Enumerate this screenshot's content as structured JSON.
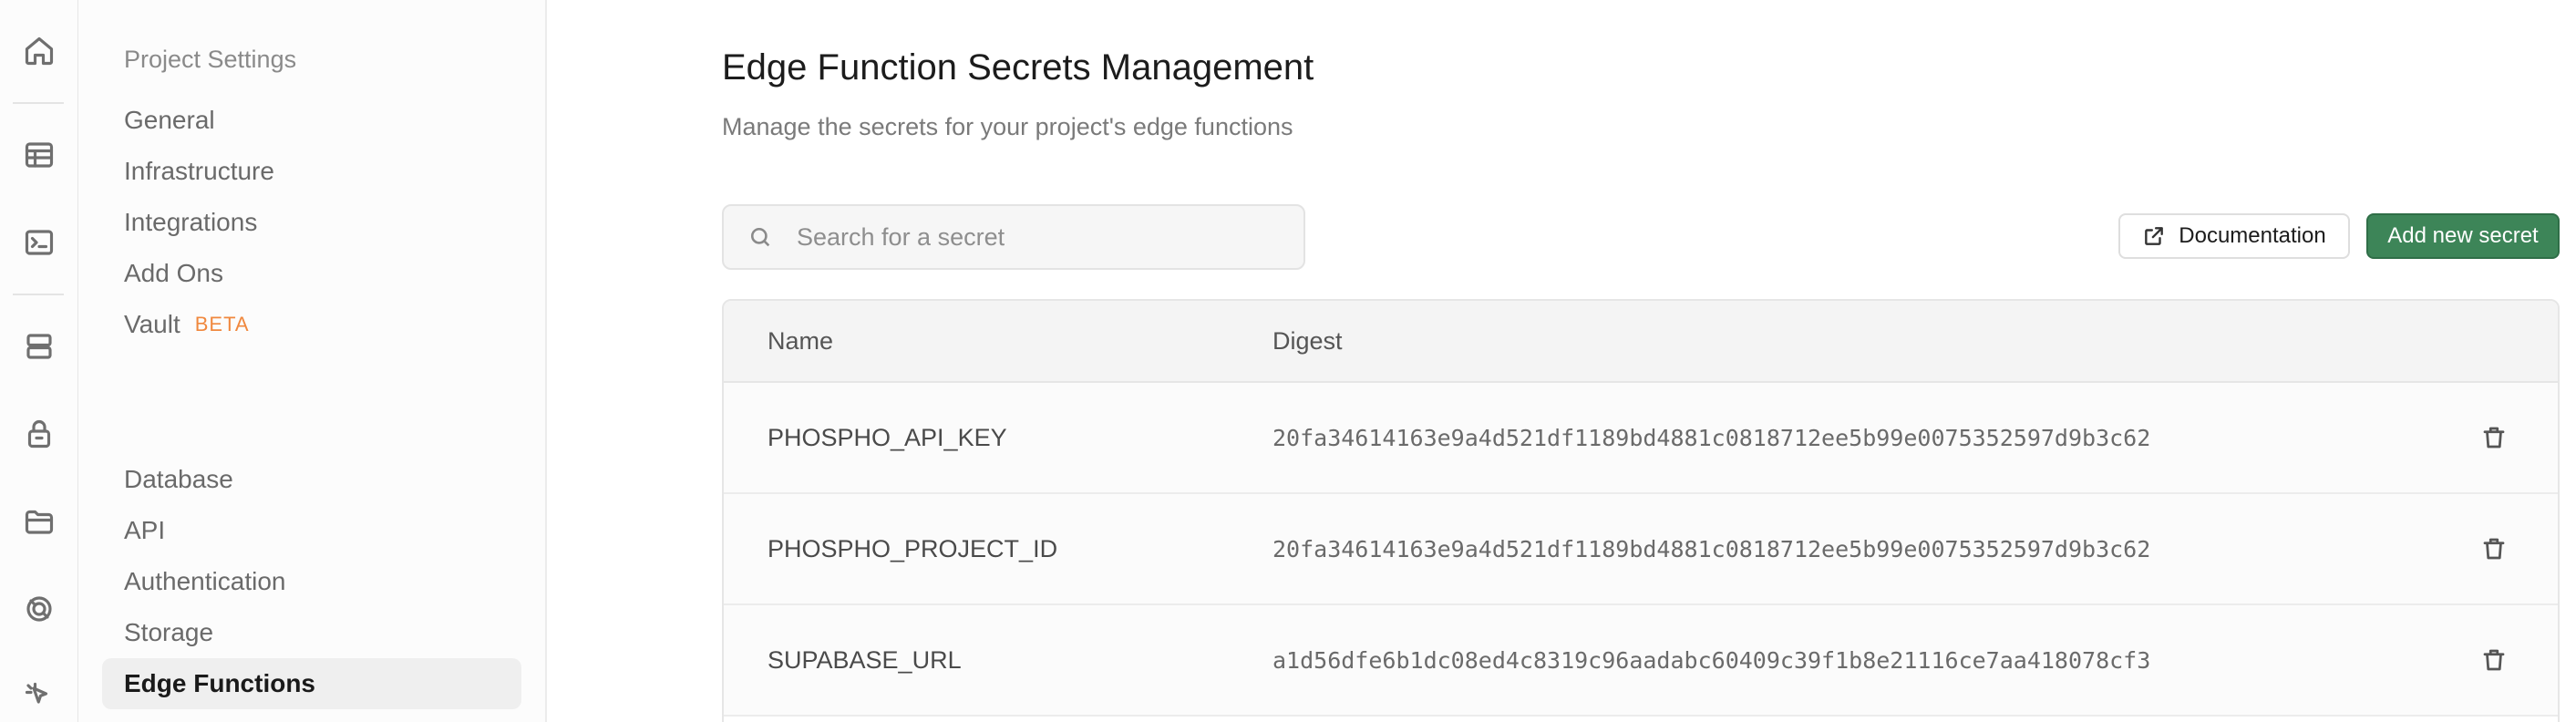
{
  "rail": {
    "icons": [
      "home-icon",
      "table-editor-icon",
      "sql-editor-icon",
      "database-icon",
      "authentication-icon",
      "storage-icon",
      "realtime-icon",
      "edge-functions-icon"
    ]
  },
  "sidebar": {
    "heading": "Project Settings",
    "project_items": [
      "General",
      "Infrastructure",
      "Integrations",
      "Add Ons",
      "Vault"
    ],
    "vault_badge": "BETA",
    "config_items": [
      "Database",
      "API",
      "Authentication",
      "Storage",
      "Edge Functions"
    ],
    "active_item": "Edge Functions"
  },
  "main": {
    "title": "Edge Function Secrets Management",
    "subtitle": "Manage the secrets for your project's edge functions",
    "search": {
      "placeholder": "Search for a secret",
      "value": ""
    },
    "documentation_label": "Documentation",
    "add_secret_label": "Add new secret",
    "accent_color": "#3d8558"
  },
  "table": {
    "columns": [
      "Name",
      "Digest"
    ],
    "rows": [
      {
        "name": "PHOSPHO_API_KEY",
        "digest": "20fa34614163e9a4d521df1189bd4881c0818712ee5b99e0075352597d9b3c62"
      },
      {
        "name": "PHOSPHO_PROJECT_ID",
        "digest": "20fa34614163e9a4d521df1189bd4881c0818712ee5b99e0075352597d9b3c62"
      },
      {
        "name": "SUPABASE_URL",
        "digest": "a1d56dfe6b1dc08ed4c8319c96aadabc60409c39f1b8e21116ce7aa418078cf3"
      }
    ]
  }
}
